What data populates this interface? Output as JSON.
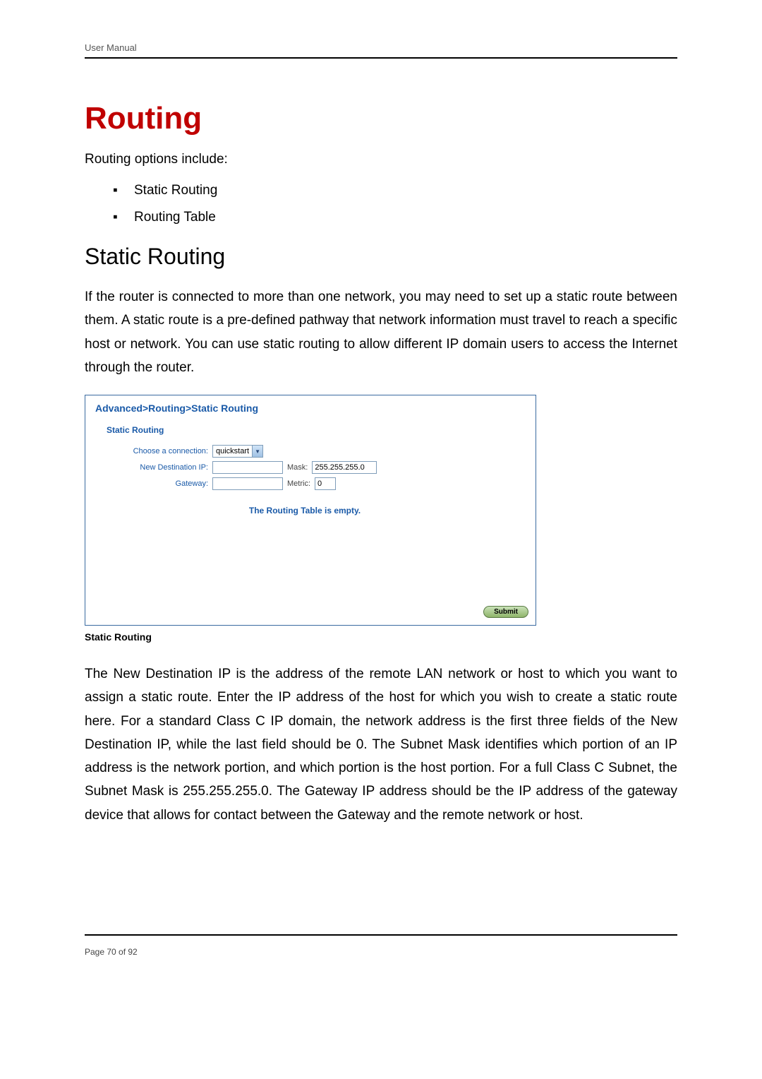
{
  "header": {
    "doc_title": "User Manual"
  },
  "title": "Routing",
  "intro": "Routing options include:",
  "bullets": [
    "Static Routing",
    "Routing Table"
  ],
  "section_heading": "Static Routing",
  "para1": "If the router is connected to more than one network, you may need to set up a static route between them. A static route is a pre-defined pathway that network information must travel to reach a specific host or network. You can use static routing to allow different IP domain users to access the Internet through the router.",
  "screenshot": {
    "breadcrumb": "Advanced>Routing>Static Routing",
    "section_label": "Static Routing",
    "choose_label": "Choose a connection:",
    "choose_value": "quickstart",
    "dest_label": "New Destination IP:",
    "dest_value": "",
    "mask_label": "Mask:",
    "mask_value": "255.255.255.0",
    "gateway_label": "Gateway:",
    "gateway_value": "",
    "metric_label": "Metric:",
    "metric_value": "0",
    "empty_msg": "The Routing Table is empty.",
    "submit": "Submit"
  },
  "caption": "Static Routing",
  "para2": "The New Destination IP is the address of the remote LAN network or host to which you want to assign a static route. Enter the IP address of the host for which you wish to create a static route here. For a standard Class C IP domain, the network address is the first three fields of the New Destination IP, while the last field should be 0. The Subnet Mask identifies which portion of an IP address is the network portion, and which portion is the host portion. For a full Class C Subnet, the Subnet Mask is 255.255.255.0. The Gateway IP address should be the IP address of the gateway device that allows for contact between the Gateway and the remote network or host.",
  "footer": {
    "page": "Page 70 of 92"
  }
}
